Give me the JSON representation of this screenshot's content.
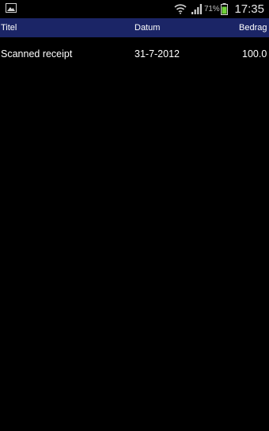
{
  "status_bar": {
    "battery_percent": "71%",
    "time": "17:35",
    "icons": {
      "left": "image-notification-icon",
      "wifi": "wifi-icon",
      "signal": "signal-icon",
      "battery": "battery-icon"
    },
    "colors": {
      "battery_fill": "#6fd13a",
      "icon": "#d0d0d0"
    }
  },
  "table": {
    "header_bg": "#1b2566",
    "columns": {
      "title": "Titel",
      "date": "Datum",
      "amount": "Bedrag"
    },
    "rows": [
      {
        "title": "Scanned receipt",
        "date": "31-7-2012",
        "amount": "100.0"
      }
    ]
  }
}
